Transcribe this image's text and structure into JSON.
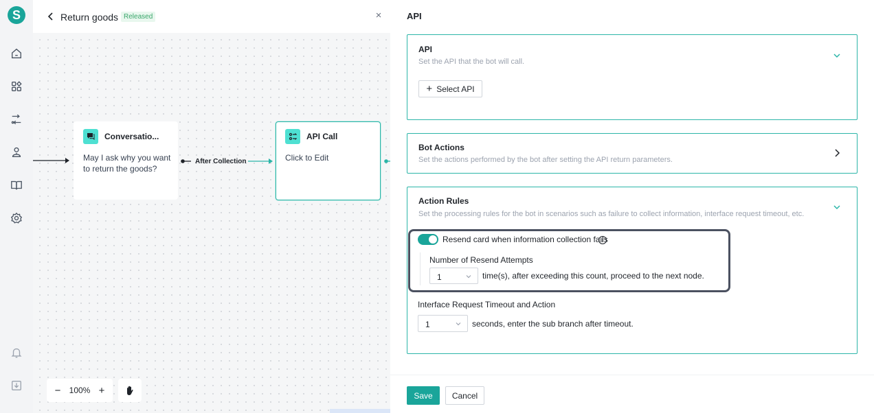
{
  "app": {
    "logo_letter": "S",
    "accent_color": "#1aa59a",
    "border_accent": "#2bb5a8"
  },
  "rail": {
    "icons": [
      "home-icon",
      "apps-icon",
      "flow-icon",
      "user-icon",
      "book-icon",
      "settings-icon",
      "bell-icon",
      "download-icon"
    ]
  },
  "canvas": {
    "title": "Return goods",
    "status_badge": "Released",
    "close_icon": "×",
    "nodes": {
      "conversation": {
        "title": "Conversatio...",
        "body_line1": "May I ask why you want",
        "body_line2": "to return the goods?",
        "icon": "chat-icon"
      },
      "api_call": {
        "title": "API Call",
        "body": "Click to Edit",
        "icon": "api-icon"
      }
    },
    "edge_label": "After Collection",
    "zoom": {
      "minus": "−",
      "level": "100%",
      "plus": "+"
    }
  },
  "panel": {
    "title": "API",
    "api_card": {
      "title": "API",
      "description": "Set the API that the bot will call.",
      "select_button": "Select API"
    },
    "bot_actions_card": {
      "title": "Bot Actions",
      "description": "Set the actions performed by the bot after setting the API return parameters."
    },
    "action_rules_card": {
      "title": "Action Rules",
      "description": "Set the processing rules for the bot in scenarios such as failure to collect information, interface request timeout, etc.",
      "resend_toggle_label": "Resend card when information collection fails",
      "resend_toggle_on": true,
      "resend_attempts_label": "Number of Resend Attempts",
      "resend_attempts_value": "1",
      "resend_attempts_suffix": "time(s), after exceeding this count, proceed to the next node.",
      "timeout_label": "Interface Request Timeout and Action",
      "timeout_value": "1",
      "timeout_suffix": "seconds, enter the sub branch after timeout."
    },
    "footer": {
      "save": "Save",
      "cancel": "Cancel"
    }
  }
}
